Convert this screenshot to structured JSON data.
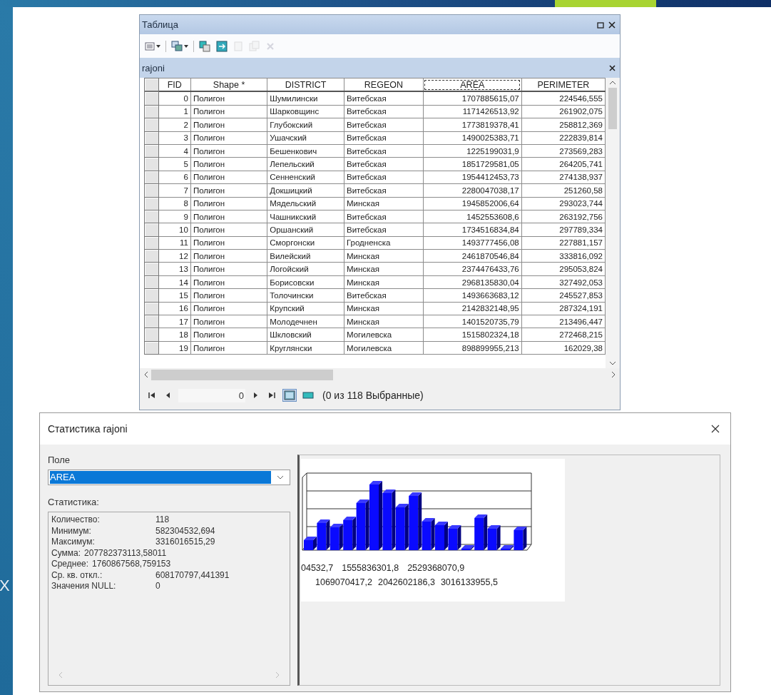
{
  "slide": {
    "fragment": "Х"
  },
  "table_window": {
    "title": "Таблица",
    "toolbar": [
      {
        "kind": "options",
        "dropdown": true,
        "disabled": false
      },
      {
        "kind": "related",
        "dropdown": true,
        "disabled": false
      },
      {
        "kind": "select",
        "dropdown": false,
        "disabled": false
      },
      {
        "kind": "switch",
        "dropdown": false,
        "disabled": false
      },
      {
        "kind": "clear",
        "dropdown": false,
        "disabled": true
      },
      {
        "kind": "copy",
        "dropdown": false,
        "disabled": true
      },
      {
        "kind": "delete",
        "dropdown": false,
        "disabled": true
      }
    ],
    "tab": {
      "label": "rajoni"
    },
    "columns": [
      {
        "label": "FID",
        "kind": "number",
        "selected": false
      },
      {
        "label": "Shape *",
        "kind": "text",
        "selected": false
      },
      {
        "label": "DISTRICT",
        "kind": "text",
        "selected": false
      },
      {
        "label": "REGEON",
        "kind": "text",
        "selected": false
      },
      {
        "label": "AREA",
        "kind": "number",
        "selected": true
      },
      {
        "label": "PERIMETER",
        "kind": "number",
        "selected": false
      }
    ],
    "rows": [
      [
        "0",
        "Полигон",
        "Шумилински",
        "Витебская",
        "1707885615,07",
        "224546,555"
      ],
      [
        "1",
        "Полигон",
        "Шарковщинс",
        "Витебская",
        "1171426513,92",
        "261902,075"
      ],
      [
        "2",
        "Полигон",
        "Глубокский",
        "Витебская",
        "1773819378,41",
        "258812,369"
      ],
      [
        "3",
        "Полигон",
        "Ушачский",
        "Витебская",
        "1490025383,71",
        "222839,814"
      ],
      [
        "4",
        "Полигон",
        "Бешенкович",
        "Витебская",
        "1225199031,9",
        "273569,283"
      ],
      [
        "5",
        "Полигон",
        "Лепельский",
        "Витебская",
        "1851729581,05",
        "264205,741"
      ],
      [
        "6",
        "Полигон",
        "Сенненский",
        "Витебская",
        "1954412453,73",
        "274138,937"
      ],
      [
        "7",
        "Полигон",
        "Докшицкий",
        "Витебская",
        "2280047038,17",
        "251260,58"
      ],
      [
        "8",
        "Полигон",
        "Мядельский",
        "Минская",
        "1945852006,64",
        "293023,744"
      ],
      [
        "9",
        "Полигон",
        "Чашникский",
        "Витебская",
        "1452553608,6",
        "263192,756"
      ],
      [
        "10",
        "Полигон",
        "Оршанский",
        "Витебская",
        "1734516834,84",
        "297789,334"
      ],
      [
        "11",
        "Полигон",
        "Сморгонски",
        "Гродненска",
        "1493777456,08",
        "227881,157"
      ],
      [
        "12",
        "Полигон",
        "Вилейский",
        "Минская",
        "2461870546,84",
        "333816,092"
      ],
      [
        "13",
        "Полигон",
        "Логойский",
        "Минская",
        "2374476433,76",
        "295053,824"
      ],
      [
        "14",
        "Полигон",
        "Борисовски",
        "Минская",
        "2968135830,04",
        "327492,053"
      ],
      [
        "15",
        "Полигон",
        "Толочински",
        "Витебская",
        "1493663683,12",
        "245527,853"
      ],
      [
        "16",
        "Полигон",
        "Крупский",
        "Минская",
        "2142832148,95",
        "287324,191"
      ],
      [
        "17",
        "Полигон",
        "Молодечнен",
        "Минская",
        "1401520735,79",
        "213496,447"
      ],
      [
        "18",
        "Полигон",
        "Шкловский",
        "Могилевска",
        "1515802324,18",
        "272468,215"
      ],
      [
        "19",
        "Полигон",
        "Круглянски",
        "Могилевска",
        "898899955,213",
        "162029,38"
      ]
    ],
    "record": "0",
    "views": [
      {
        "kind": "all",
        "selected": true
      },
      {
        "kind": "selected",
        "selected": false
      }
    ],
    "status": "(0 из 118 Выбранные)"
  },
  "stats_dialog": {
    "title": "Статистика rajoni",
    "field_label": "Поле",
    "field_value": "AREA",
    "stats_label": "Статистика:",
    "stats": [
      {
        "label": "Количество:",
        "value": "118",
        "kind": "column"
      },
      {
        "label": "Минимум:",
        "value": "582304532,694",
        "kind": "column"
      },
      {
        "label": "Максимум:",
        "value": "3316016515,29",
        "kind": "column"
      },
      {
        "label": "Сумма:",
        "value": "207782373113,58011",
        "kind": "inline"
      },
      {
        "label": "Среднее:",
        "value": "1760867568,759153",
        "kind": "inline"
      },
      {
        "label": "Ср. кв. откл.:",
        "value": "608170797,441391",
        "kind": "column"
      },
      {
        "label": "Значения NULL:",
        "value": "0",
        "kind": "column"
      }
    ],
    "axis_rows": [
      [
        "04532,7",
        "1555836301,8",
        "2529368070,9"
      ],
      [
        "1069070417,2",
        "2042602186,3",
        "3016133955,5"
      ]
    ]
  }
}
